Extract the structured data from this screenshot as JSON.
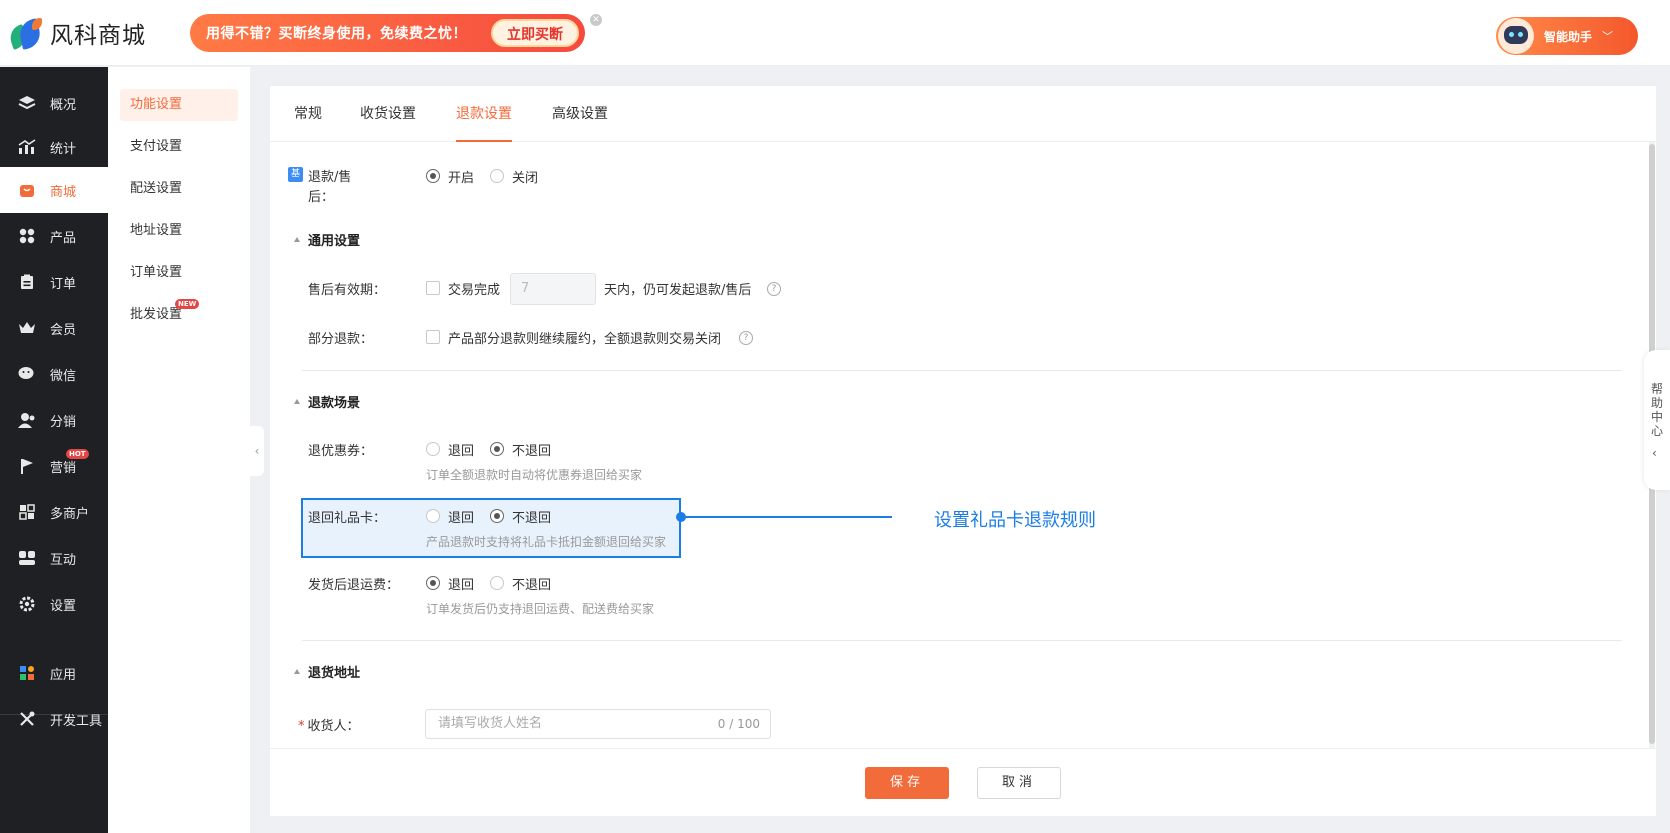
{
  "header": {
    "logo_text": "风科商城",
    "promo_text": "用得不错？买断终身使用，免续费之忧！",
    "promo_button": "立即买断",
    "assistant_label": "智能助手"
  },
  "sidebar": {
    "items": [
      {
        "label": "概况",
        "icon": "layers-icon"
      },
      {
        "label": "统计",
        "icon": "chart-icon"
      },
      {
        "label": "商城",
        "icon": "shop-bag-icon"
      },
      {
        "label": "产品",
        "icon": "grid-icon"
      },
      {
        "label": "订单",
        "icon": "clipboard-icon"
      },
      {
        "label": "会员",
        "icon": "crown-icon"
      },
      {
        "label": "微信",
        "icon": "wechat-icon"
      },
      {
        "label": "分销",
        "icon": "users-icon"
      },
      {
        "label": "营销",
        "icon": "flag-icon",
        "badge": "HOT"
      },
      {
        "label": "多商户",
        "icon": "store-icon"
      },
      {
        "label": "互动",
        "icon": "people-icon"
      },
      {
        "label": "设置",
        "icon": "gear-icon"
      },
      {
        "label": "应用",
        "icon": "apps-icon"
      },
      {
        "label": "开发工具",
        "icon": "tools-icon"
      }
    ],
    "active": "商城"
  },
  "subnav": {
    "items": [
      {
        "label": "功能设置"
      },
      {
        "label": "支付设置"
      },
      {
        "label": "配送设置"
      },
      {
        "label": "地址设置"
      },
      {
        "label": "订单设置"
      },
      {
        "label": "批发设置",
        "badge": "NEW"
      }
    ]
  },
  "tabs": [
    "常规",
    "收货设置",
    "退款设置",
    "高级设置"
  ],
  "active_tab": "退款设置",
  "form": {
    "refund_tag": "基",
    "refund_label_line1": "退款/售",
    "refund_label_line2": "后：",
    "refund_on": "开启",
    "refund_off": "关闭",
    "general_section": "通用设置",
    "aftersale_label": "售后有效期：",
    "aftersale_checkbox": "交易完成",
    "aftersale_days": "7",
    "aftersale_suffix": "天内，仍可发起退款/售后",
    "partial_label": "部分退款：",
    "partial_checkbox": "产品部分退款则继续履约，全额退款则交易关闭",
    "scene_section": "退款场景",
    "coupon_label": "退优惠券：",
    "coupon_yes": "退回",
    "coupon_no": "不退回",
    "coupon_hint": "订单全额退款时自动将优惠券退回给买家",
    "giftcard_label": "退回礼品卡：",
    "giftcard_yes": "退回",
    "giftcard_no": "不退回",
    "giftcard_hint": "产品退款时支持将礼品卡抵扣金额退回给买家",
    "shipping_label": "发货后退运费：",
    "shipping_yes": "退回",
    "shipping_no": "不退回",
    "shipping_hint": "订单发货后仍支持退回运费、配送费给买家",
    "return_section": "退货地址",
    "receiver_required": "*",
    "receiver_label": "收货人：",
    "receiver_placeholder": "请填写收货人姓名",
    "receiver_count": "0 / 100"
  },
  "callout": "设置礼品卡退款规则",
  "footer": {
    "save": "保存",
    "cancel": "取消"
  },
  "help_center": "帮助中心",
  "colors": {
    "accent": "#f26b3a",
    "highlight": "#1b7ee8",
    "sidebar_bg": "#1f2023"
  }
}
